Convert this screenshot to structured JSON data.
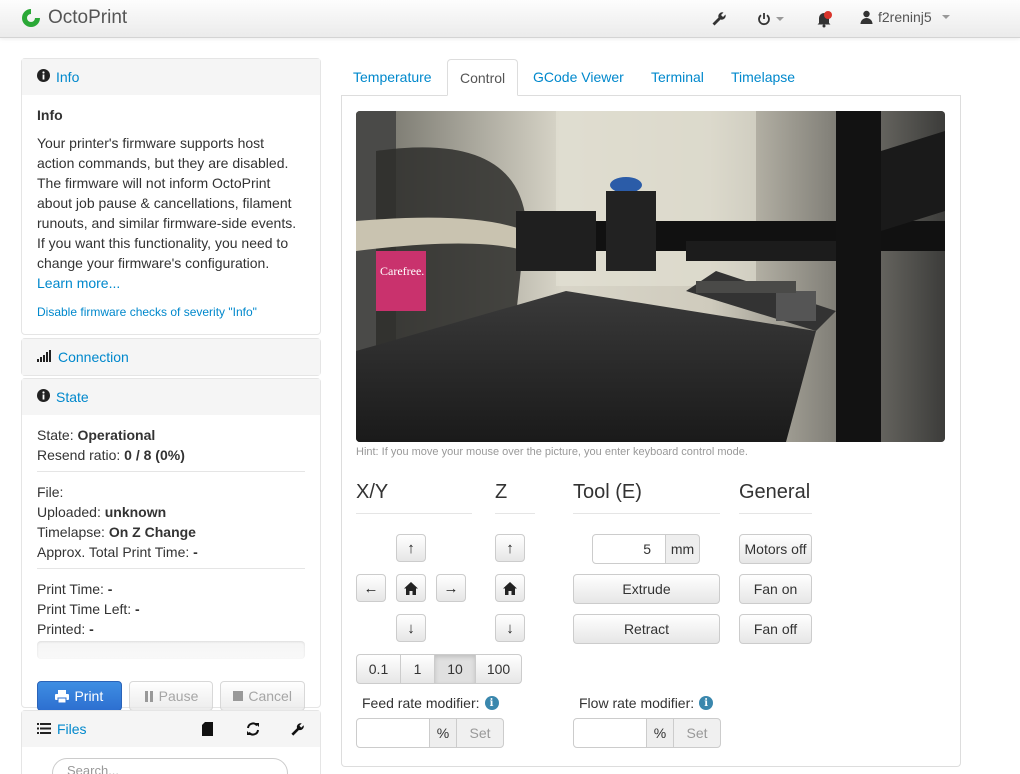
{
  "navbar": {
    "brand": "OctoPrint",
    "username": "f2reninj5"
  },
  "sidebar": {
    "info": {
      "header": "Info",
      "title": "Info",
      "text": "Your printer's firmware supports host action commands, but they are disabled. The firmware will not inform OctoPrint about job pause & cancellations, filament runouts, and similar firmware-side events. If you want this functionality, you need to change your firmware's configuration.",
      "learn_more": "Learn more...",
      "disable_link": "Disable firmware checks of severity \"Info\""
    },
    "connection": {
      "header": "Connection"
    },
    "state": {
      "header": "State",
      "state_label": "State:",
      "state_value": "Operational",
      "resend_label": "Resend ratio:",
      "resend_value": "0 / 8 (0%)",
      "file_label": "File:",
      "uploaded_label": "Uploaded:",
      "uploaded_value": "unknown",
      "timelapse_label": "Timelapse:",
      "timelapse_value": "On Z Change",
      "approx_label": "Approx. Total Print Time:",
      "approx_value": "-",
      "print_time_label": "Print Time:",
      "print_time_value": "-",
      "print_time_left_label": "Print Time Left:",
      "print_time_left_value": "-",
      "printed_label": "Printed:",
      "printed_value": "-",
      "progress": 0,
      "print_button": "Print",
      "pause_button": "Pause",
      "cancel_button": "Cancel"
    },
    "files": {
      "header": "Files",
      "search_placeholder": "Search..."
    }
  },
  "tabs": [
    {
      "label": "Temperature",
      "active": false
    },
    {
      "label": "Control",
      "active": true
    },
    {
      "label": "GCode Viewer",
      "active": false
    },
    {
      "label": "Terminal",
      "active": false
    },
    {
      "label": "Timelapse",
      "active": false
    }
  ],
  "control": {
    "hint": "Hint: If you move your mouse over the picture, you enter keyboard control mode.",
    "headings": {
      "xy": "X/Y",
      "z": "Z",
      "tool": "Tool (E)",
      "general": "General"
    },
    "step_sizes": [
      "0.1",
      "1",
      "10",
      "100"
    ],
    "active_step": "10",
    "extrude_amount": "5",
    "extrude_unit": "mm",
    "extrude_button": "Extrude",
    "retract_button": "Retract",
    "motors_off": "Motors off",
    "fan_on": "Fan on",
    "fan_off": "Fan off",
    "feed_rate_label": "Feed rate modifier:",
    "flow_rate_label": "Flow rate modifier:",
    "percent": "%",
    "set": "Set"
  },
  "colors": {
    "link": "#0088cc",
    "primary": "#3e8ee3",
    "alert": "#d9342b"
  },
  "icons": {
    "brand": "octoprint-logo",
    "settings": "wrench-icon",
    "system": "power-icon",
    "notifications": "bell-alert-icon",
    "user": "user-icon"
  }
}
